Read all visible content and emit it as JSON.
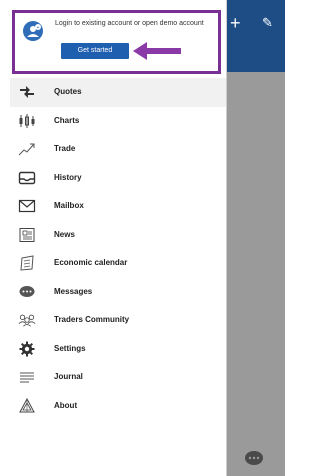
{
  "login": {
    "message": "Login to existing account or open demo account",
    "button_label": "Get started"
  },
  "menu": {
    "items": [
      {
        "label": "Quotes",
        "icon": "quotes-icon",
        "active": true
      },
      {
        "label": "Charts",
        "icon": "charts-icon",
        "active": false
      },
      {
        "label": "Trade",
        "icon": "trade-icon",
        "active": false
      },
      {
        "label": "History",
        "icon": "history-icon",
        "active": false
      },
      {
        "label": "Mailbox",
        "icon": "mailbox-icon",
        "active": false
      },
      {
        "label": "News",
        "icon": "news-icon",
        "active": false
      },
      {
        "label": "Economic calendar",
        "icon": "economic-calendar-icon",
        "active": false
      },
      {
        "label": "Messages",
        "icon": "messages-icon",
        "active": false
      },
      {
        "label": "Traders Community",
        "icon": "traders-community-icon",
        "active": false
      },
      {
        "label": "Settings",
        "icon": "settings-icon",
        "active": false
      },
      {
        "label": "Journal",
        "icon": "journal-icon",
        "active": false
      },
      {
        "label": "About",
        "icon": "about-icon",
        "active": false
      }
    ]
  },
  "colors": {
    "header_blue": "#1e4d86",
    "button_blue": "#1f5fb0",
    "highlight_purple": "#7a2f95",
    "overlay_gray": "#9a9a9a"
  }
}
